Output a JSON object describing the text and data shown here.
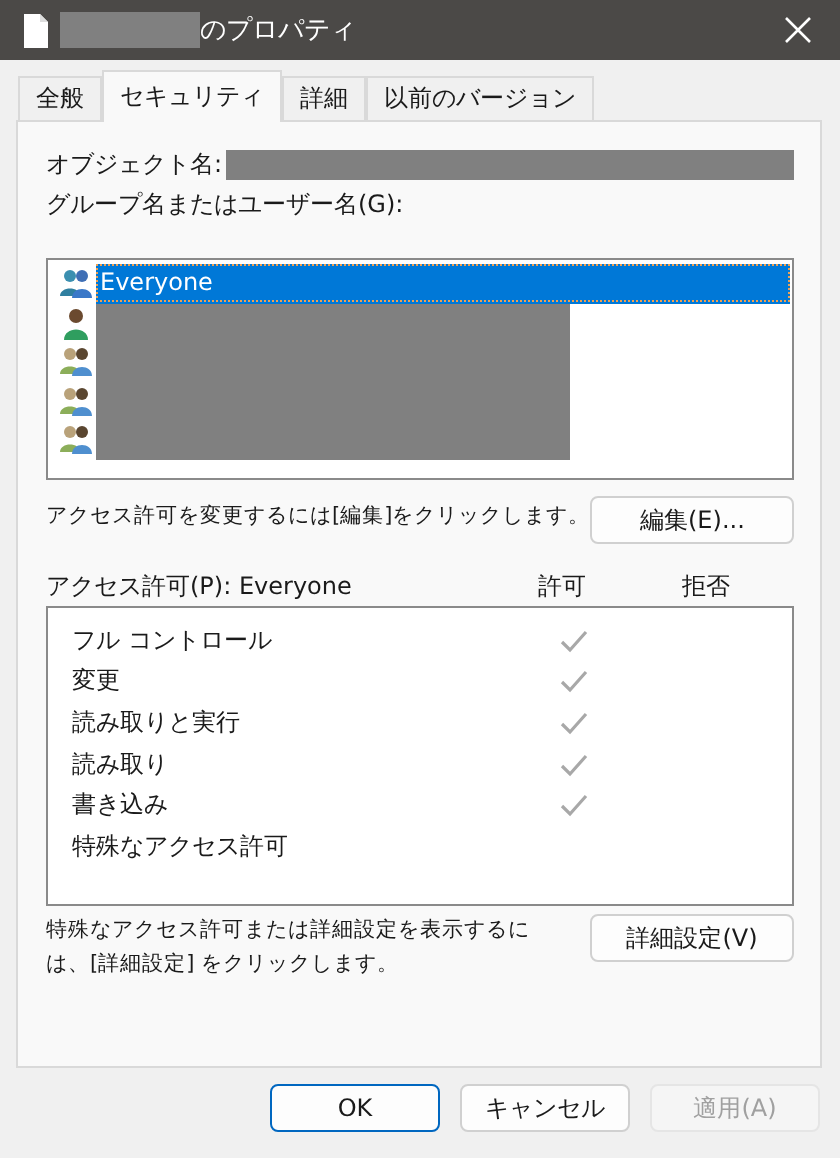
{
  "window": {
    "title": "のプロパティ",
    "title_redacted": true
  },
  "tabs": [
    {
      "label": "全般",
      "selected": false
    },
    {
      "label": "セキュリティ",
      "selected": true
    },
    {
      "label": "詳細",
      "selected": false
    },
    {
      "label": "以前のバージョン",
      "selected": false
    }
  ],
  "object_label": "オブジェクト名:",
  "object_redacted": true,
  "principals_label": "グループ名またはユーザー名(G):",
  "principals": [
    {
      "name": "Everyone",
      "kind": "group",
      "selected": true
    },
    {
      "kind": "user",
      "redacted": true,
      "selected": false
    },
    {
      "kind": "group",
      "redacted": true,
      "selected": false
    },
    {
      "kind": "group",
      "redacted": true,
      "selected": false
    },
    {
      "kind": "group",
      "redacted": true,
      "selected": false
    }
  ],
  "edit_hint": "アクセス許可を変更するには[編集]をクリックします。",
  "edit_button": "編集(E)...",
  "permissions_label": "アクセス許可(P): Everyone",
  "allow_header": "許可",
  "deny_header": "拒否",
  "permissions": [
    {
      "name": "フル コントロール",
      "allow": true,
      "deny": false
    },
    {
      "name": "変更",
      "allow": true,
      "deny": false
    },
    {
      "name": "読み取りと実行",
      "allow": true,
      "deny": false
    },
    {
      "name": "読み取り",
      "allow": true,
      "deny": false
    },
    {
      "name": "書き込み",
      "allow": true,
      "deny": false
    },
    {
      "name": "特殊なアクセス許可",
      "allow": false,
      "deny": false
    }
  ],
  "advanced_hint": "特殊なアクセス許可または詳細設定を表示するには、[詳細設定] をクリックします。",
  "advanced_button": "詳細設定(V)",
  "buttons": [
    {
      "label": "OK",
      "default": true,
      "disabled": false
    },
    {
      "label": "キャンセル",
      "default": false,
      "disabled": false
    },
    {
      "label": "適用(A)",
      "default": false,
      "disabled": true
    }
  ]
}
